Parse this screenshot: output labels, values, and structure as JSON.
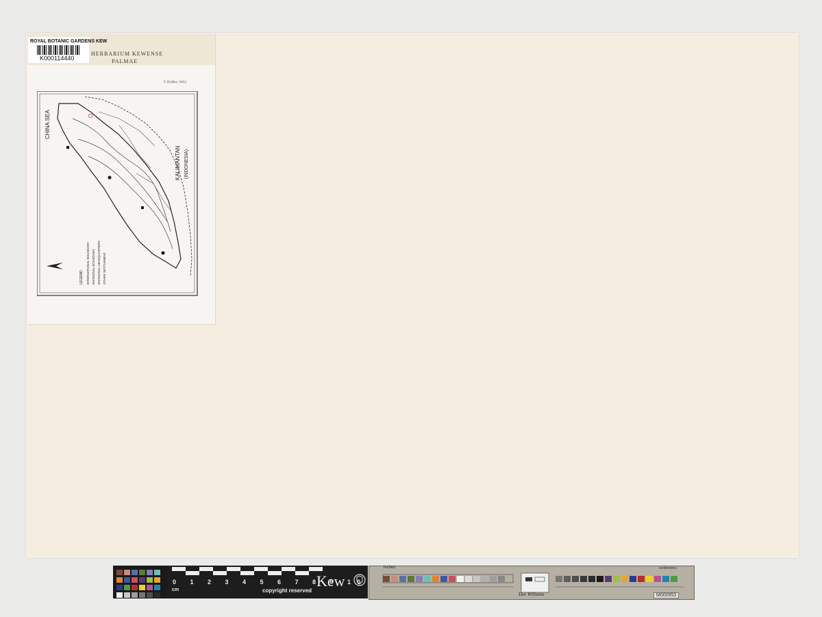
{
  "barcode_label": {
    "institution": "ROYAL BOTANIC GARDENS KEW",
    "number": "K000114440"
  },
  "packet": {
    "herbarium": "HERBARIUM KEWENSE",
    "family": "PALMAE",
    "form_code": "F 28 (Rev. 3/81)"
  },
  "map": {
    "sea_label": "CHINA SEA",
    "region_label": "KALIMANTAN",
    "country_label": "(INDONESIA)",
    "legend_title": "LEGEND",
    "legend_items": [
      "INTERNATIONAL BOUNDARY",
      "DIVISIONAL BOUNDARY",
      "DIVISIONAL HEADQUARTERS",
      "OTHER SETTLEMENT"
    ]
  },
  "ruler": {
    "digits": "0 1 2 3 4 5 6 7 8 9 10",
    "unit": "cm",
    "copyright": "copyright reserved",
    "logo": "Kew",
    "inches_label": "inches",
    "centimetres_label": "centimetres",
    "brand": "Dee Williams",
    "target_id": "M000953"
  },
  "colors": {
    "sheet": "#f5ede0",
    "background": "#ebebea",
    "ruler": "#1d1d1d"
  }
}
